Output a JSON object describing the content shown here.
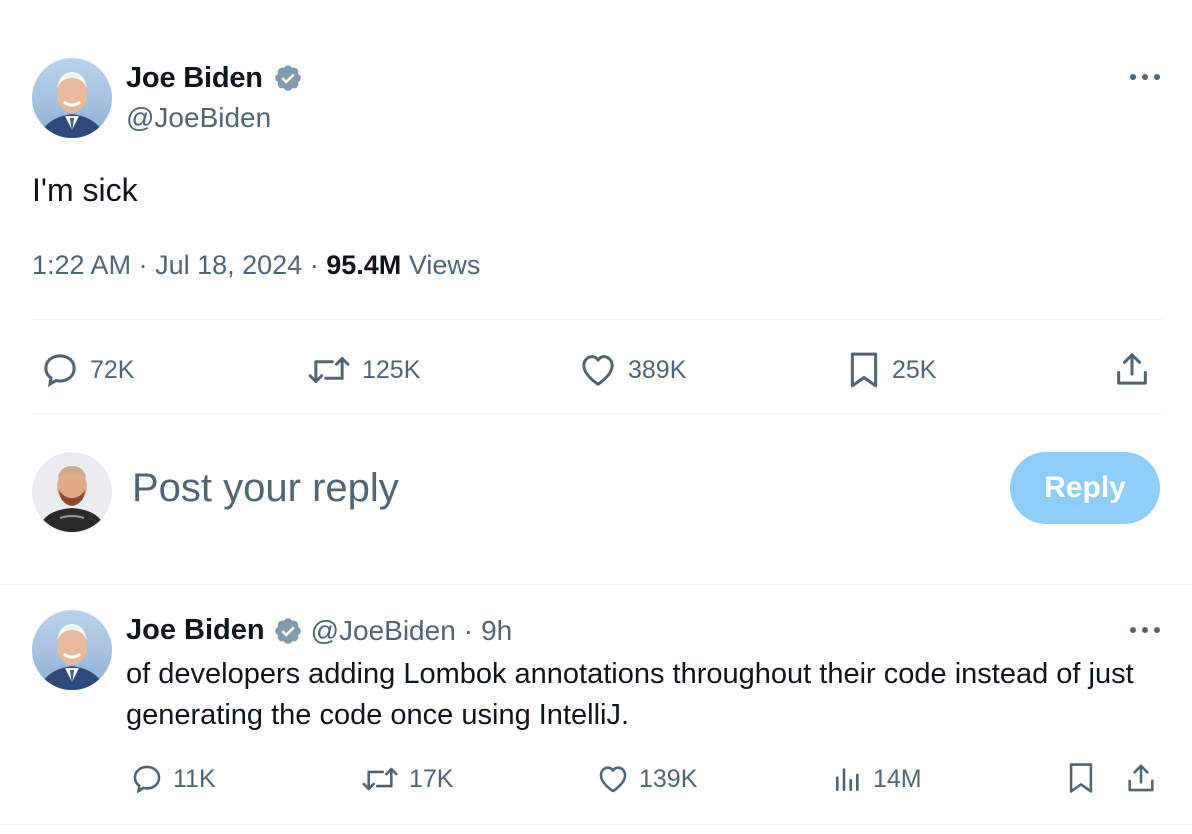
{
  "main_post": {
    "author_name": "Joe Biden",
    "author_handle": "@JoeBiden",
    "verified_badge_color": "#829aab",
    "text": "I'm sick",
    "time": "1:22 AM",
    "date": "Jul 18, 2024",
    "views_count": "95.4M",
    "views_label": "Views",
    "separator": "·",
    "more_icon": "ellipsis-icon",
    "actions": {
      "replies": "72K",
      "reposts": "125K",
      "likes": "389K",
      "bookmarks": "25K"
    }
  },
  "reply_box": {
    "placeholder": "Post your reply",
    "button_label": "Reply",
    "button_color": "#8ecdf8"
  },
  "reply_post": {
    "author_name": "Joe Biden",
    "author_handle": "@JoeBiden",
    "separator": "·",
    "time_ago": "9h",
    "text": "of developers adding Lombok annotations throughout their code instead of just generating the code once using IntelliJ.",
    "actions": {
      "replies": "11K",
      "reposts": "17K",
      "likes": "139K",
      "views": "14M"
    }
  },
  "colors": {
    "text_primary": "#0f1419",
    "text_secondary": "#536471",
    "divider": "#eff3f4"
  }
}
